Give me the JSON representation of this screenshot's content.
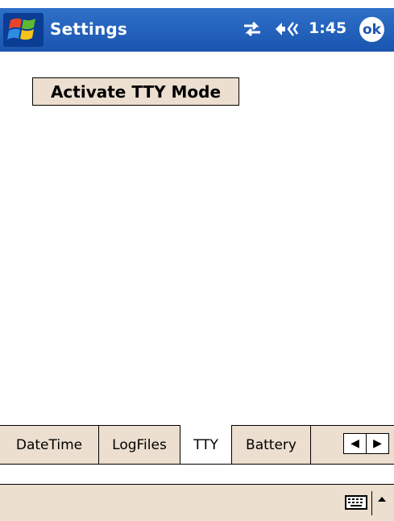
{
  "titlebar": {
    "title": "Settings",
    "time": "1:45",
    "ok_label": "ok",
    "start_icon": "windows-flag-icon",
    "connectivity_icon": "connectivity-icon",
    "volume_icon": "volume-icon"
  },
  "content": {
    "tty_button_label": "Activate TTY Mode"
  },
  "tabs": [
    {
      "label": "DateTime",
      "active": false
    },
    {
      "label": "LogFiles",
      "active": false
    },
    {
      "label": "TTY",
      "active": true
    },
    {
      "label": "Battery",
      "active": false
    }
  ],
  "tab_scroll": {
    "left": "◀",
    "right": "▶"
  },
  "menubar": {
    "keyboard_icon": "keyboard-icon",
    "sip_arrow": "up-arrow-icon"
  },
  "colors": {
    "titlebar": "#1a55b0",
    "chrome": "#ecdfcf",
    "background": "#ffffff"
  }
}
